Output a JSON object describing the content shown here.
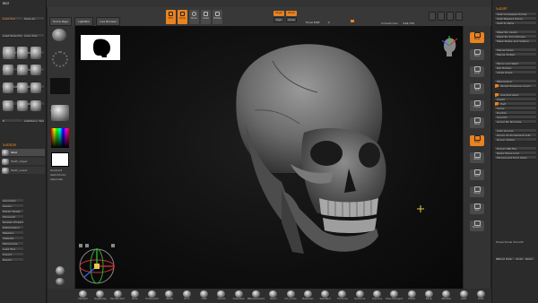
{
  "menubar": {
    "items": [
      "Alpha",
      "Brush",
      "Color",
      "Document",
      "Draw",
      "Dynamics",
      "Edit",
      "File",
      "Layer",
      "Light",
      "Macro",
      "Marker",
      "Material",
      "Movie",
      "Picker",
      "Preferences",
      "Render",
      "Stencil",
      "Stroke",
      "Texture",
      "Tool",
      "Transform",
      "Zplugin",
      "Zscript",
      "Help"
    ],
    "right": "My Menu"
  },
  "topbar": {
    "tabs": [
      "Home Page",
      "LightBox",
      "Live Boolean"
    ],
    "modes": [
      "Edit",
      "Draw",
      "Move",
      "Scale",
      "Rotate"
    ],
    "focal_label": "Focal Shift",
    "focal_value": "0",
    "draw_size_label": "Draw Size",
    "draw_size_value": "64",
    "active_points_label": "ActivePoints:",
    "active_points_value": "219,734",
    "total_points_label": "TotalPoints:",
    "total_points_value": "219,734",
    "rgb_label": "Rgb",
    "zadd_label": "Zadd",
    "zsub_label": "Zsub",
    "mrgb_label": "Mrgb"
  },
  "left_panel": {
    "header": "Tool",
    "buttons": [
      "Load Tool",
      "Save As",
      "Load Tools From Project",
      "Copy Tool",
      "Paste Tool",
      "Import",
      "Export",
      "Clone",
      "Make PolyMesh3D",
      "GoZ",
      "All",
      "Visible",
      "R",
      "Lightbox> Tools"
    ],
    "tool_name": "Skull_52",
    "subtool_header": "Subtool",
    "subtools": [
      "Skull",
      "Teeth_Upper",
      "Teeth_Lower"
    ],
    "sections": [
      "Geometry",
      "Layers",
      "Morph Target",
      "Polypaint",
      "Display Properties",
      "Deformation",
      "Masking",
      "Visibility",
      "Polygroups",
      "Contact",
      "UV Map",
      "Texture Map",
      "Displacement Map",
      "Normal Map",
      "Vector Displacement",
      "Preview"
    ],
    "bottom_buttons": [
      "Load Tool",
      "Import",
      "Export"
    ]
  },
  "shelf_left": {
    "labels": [
      "Standard",
      "Move",
      "ClayBuildup",
      "Alpha Off",
      "Texture Off",
      "Gradient",
      "SwitchColor",
      "Alternate"
    ]
  },
  "right_panel": {
    "header": "My Menu",
    "title": "SubdP",
    "buttons": [
      "Split Unmasked Points",
      "Split Masked Points",
      "Split To Parts",
      "Mask By Cavity",
      "Mask By Smoothness",
      "Mask Peaks And Valleys",
      "Merge Down",
      "Merge Visible",
      "Mirror And Weld",
      "Del Hidden",
      "Close Holes",
      "ZRemesher",
      "Target Polygons Count",
      "Use Polypaint",
      "Adapt",
      "Half",
      "Same",
      "Double",
      "Smooth",
      "Group By Normals",
      "Auto Groups",
      "Group As Dynamesh Sub",
      "Group Visible",
      "Export OBJ File",
      "Relax Plane Grid",
      "Polygroupit From Paint"
    ],
    "bottom_label": "Proportional Smooth",
    "bottom_buttons": [
      "ZBrush Version",
      "Help",
      "Undo",
      "Redo"
    ]
  },
  "shelf_right": {
    "labels": [
      "Persp",
      "Floor",
      "Local",
      "XYZ",
      "Frame",
      "Move",
      "Scale",
      "Rotate",
      "PolyF",
      "Transp",
      "Solo",
      "Dynamic"
    ]
  },
  "bottombar": {
    "brushes": [
      "Standard",
      "ClayBuildup",
      "DamStandard",
      "Move",
      "TrimDynamic",
      "hPolish",
      "Pinch",
      "Inflat",
      "Smooth",
      "SnakeHook",
      "ZRemesherGuides",
      "Slash3",
      "Orb_Cracks",
      "MaskLasso",
      "SelectRect",
      "TrimCurve",
      "SliceCurve",
      "ClipCurve",
      "Move Topological",
      "Flatten",
      "Planar",
      "ZModeler",
      "Insert",
      "Polish"
    ]
  },
  "viewport": {
    "model": "skull"
  },
  "colors": {
    "accent": "#e9821f",
    "panel": "#2c2c2c",
    "viewport_bg": "#111111"
  }
}
